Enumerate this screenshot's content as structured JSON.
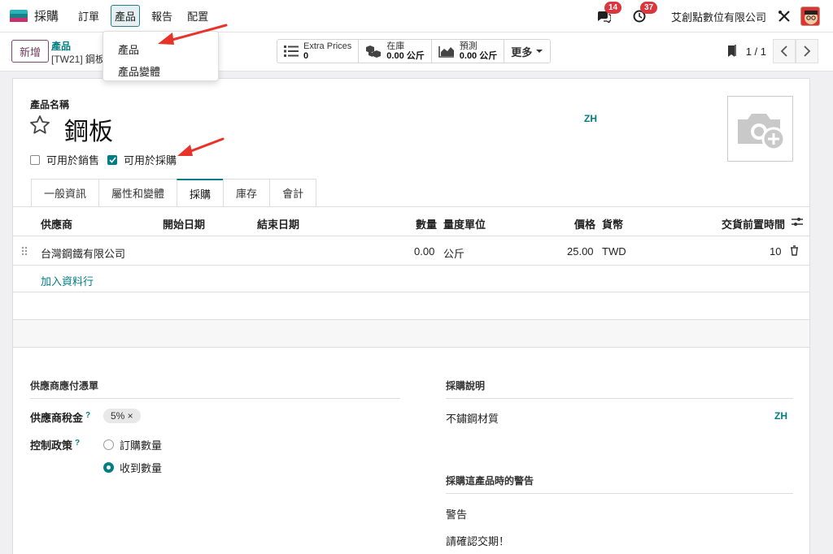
{
  "nav": {
    "app_name": "採購",
    "menu": [
      "訂單",
      "產品",
      "報告",
      "配置"
    ],
    "messages_badge": "14",
    "activities_badge": "37",
    "company": "艾創點數位有限公司"
  },
  "dropdown": {
    "items": [
      "產品",
      "產品變體"
    ]
  },
  "control": {
    "new_button": "新增",
    "breadcrumb_parent": "產品",
    "breadcrumb_current": "[TW21] 鋼板",
    "stats": [
      {
        "label": "Extra Prices",
        "value": "0",
        "icon": "list-icon"
      },
      {
        "label": "在庫",
        "value": "0.00 公斤",
        "icon": "cubes-icon"
      },
      {
        "label": "預測",
        "value": "0.00 公斤",
        "icon": "area-chart-icon"
      }
    ],
    "more_label": "更多",
    "pager": "1 / 1"
  },
  "form": {
    "name_label": "產品名稱",
    "product_name": "鋼板",
    "lang": "ZH",
    "can_be_sold_label": "可用於銷售",
    "can_be_sold": false,
    "can_be_purchased_label": "可用於採購",
    "can_be_purchased": true,
    "tabs": [
      "一般資訊",
      "屬性和變體",
      "採購",
      "庫存",
      "會計"
    ],
    "active_tab": "採購"
  },
  "vendor_table": {
    "columns": [
      "供應商",
      "開始日期",
      "結束日期",
      "數量",
      "量度單位",
      "價格",
      "貨幣",
      "交貨前置時間"
    ],
    "rows": [
      {
        "vendor": "台灣鋼鐵有限公司",
        "start": "",
        "end": "",
        "qty": "0.00",
        "uom": "公斤",
        "price": "25.00",
        "currency": "TWD",
        "lead_time": "10"
      }
    ],
    "add_line": "加入資料行"
  },
  "bills": {
    "title": "供應商應付憑單",
    "tax_label": "供應商稅金",
    "tax_tag": "5% ×",
    "control_label": "控制政策",
    "policies": [
      {
        "label": "訂購數量",
        "selected": false
      },
      {
        "label": "收到數量",
        "selected": true
      }
    ]
  },
  "purchase_desc": {
    "title": "採購說明",
    "text": "不鏽鋼材質",
    "lang": "ZH"
  },
  "warning": {
    "title": "採購這產品時的警告",
    "label": "警告",
    "message": "請確認交期！"
  },
  "colors": {
    "accent": "#017e84",
    "brand": "#71405f",
    "badge": "#d9363e",
    "arrow": "#e8332a"
  }
}
